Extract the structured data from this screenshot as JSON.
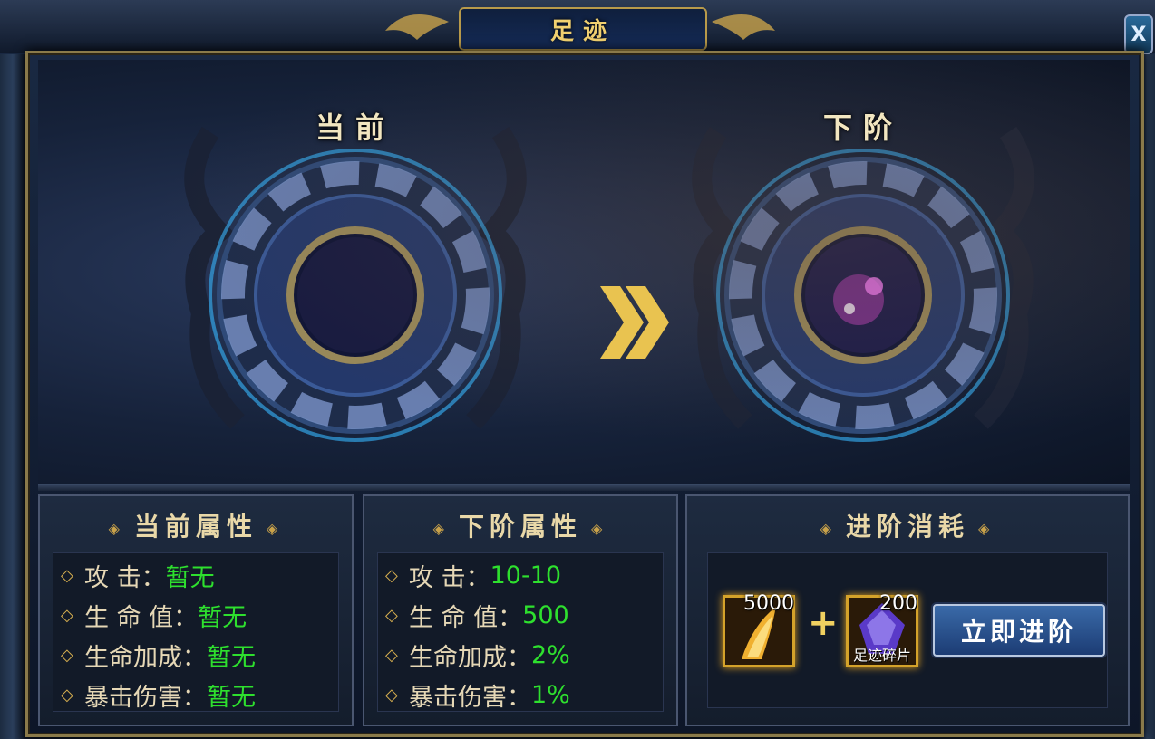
{
  "window": {
    "title": "足迹",
    "close_label": "X"
  },
  "stages": {
    "current_label": "当前",
    "next_label": "下阶"
  },
  "current_attrs": {
    "title": "当前属性",
    "rows": [
      {
        "label": "攻      击：",
        "value": "暂无"
      },
      {
        "label": "生  命  值：",
        "value": "暂无"
      },
      {
        "label": "生命加成：",
        "value": "暂无"
      },
      {
        "label": "暴击伤害：",
        "value": "暂无"
      }
    ]
  },
  "next_attrs": {
    "title": "下阶属性",
    "rows": [
      {
        "label": "攻      击：",
        "value": "10-10"
      },
      {
        "label": "生  命  值：",
        "value": "500"
      },
      {
        "label": "生命加成：",
        "value": "2%"
      },
      {
        "label": "暴击伤害：",
        "value": "1%"
      }
    ]
  },
  "cost": {
    "title": "进阶消耗",
    "items": [
      {
        "count": "5000",
        "name": "",
        "icon": "gold-wing-icon"
      },
      {
        "count": "200",
        "name": "足迹碎片",
        "icon": "purple-crystal-icon"
      }
    ],
    "plus": "+",
    "advance_button": "立即进阶"
  },
  "colors": {
    "accent_gold": "#d4a22a",
    "value_green": "#2ee02e",
    "label_cream": "#e6d8b6"
  }
}
